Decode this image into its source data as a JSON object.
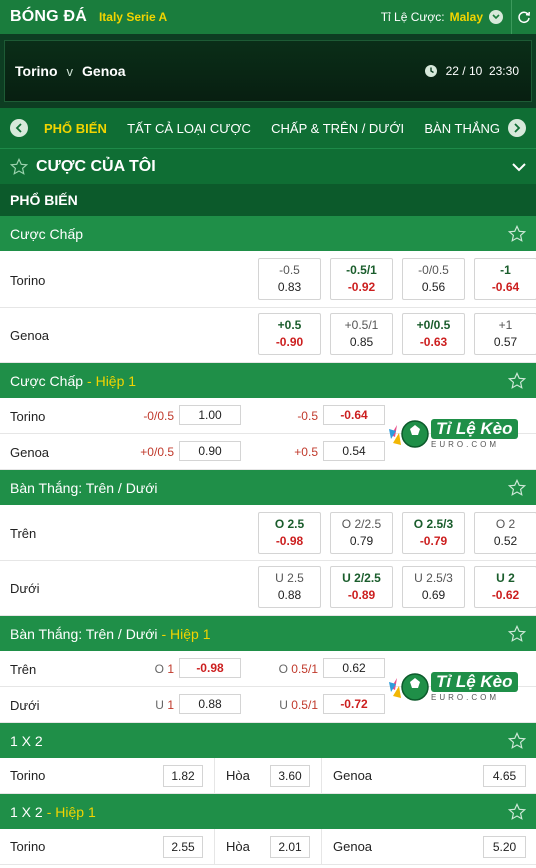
{
  "header": {
    "brand": "BÓNG ĐÁ",
    "league": "Italy Serie A",
    "odds_label": "Tỉ Lệ Cược:",
    "odds_value": "Malay"
  },
  "match": {
    "home": "Torino",
    "vs": "v",
    "away": "Genoa",
    "datetime": "22 / 10  23:30"
  },
  "tabs": [
    {
      "label": "PHỔ BIẾN",
      "active": true
    },
    {
      "label": "TẤT CẢ LOẠI CƯỢC"
    },
    {
      "label": "CHẤP & TRÊN / DƯỚI"
    },
    {
      "label": "BÀN THẮNG"
    }
  ],
  "my_bets": {
    "title": "CƯỢC CỦA TÔI"
  },
  "popular": {
    "title": "PHỔ BIẾN"
  },
  "handicap": {
    "title": "Cược Chấp",
    "rows": [
      {
        "team": "Torino",
        "cells": [
          {
            "line": "-0.5",
            "odd": "0.83"
          },
          {
            "line": "-0.5/1",
            "odd": "-0.92"
          },
          {
            "line": "-0/0.5",
            "odd": "0.56"
          },
          {
            "line": "-1",
            "odd": "-0.64"
          }
        ]
      },
      {
        "team": "Genoa",
        "cells": [
          {
            "line": "+0.5",
            "odd": "-0.90"
          },
          {
            "line": "+0.5/1",
            "odd": "0.85"
          },
          {
            "line": "+0/0.5",
            "odd": "-0.63"
          },
          {
            "line": "+1",
            "odd": "0.57"
          }
        ]
      }
    ]
  },
  "handicap_h1": {
    "title": "Cược Chấp",
    "half": "- Hiệp 1",
    "rows": [
      {
        "team": "Torino",
        "line1": "-0/0.5",
        "odd1": "1.00",
        "line2": "-0.5",
        "odd2": "-0.64"
      },
      {
        "team": "Genoa",
        "line1": "+0/0.5",
        "odd1": "0.90",
        "line2": "+0.5",
        "odd2": "0.54"
      }
    ]
  },
  "overunder": {
    "title": "Bàn Thắng: Trên / Dưới",
    "rows": [
      {
        "team": "Trên",
        "cells": [
          {
            "prefix": "O",
            "line": "2.5",
            "odd": "-0.98"
          },
          {
            "prefix": "O",
            "line": "2/2.5",
            "odd": "0.79"
          },
          {
            "prefix": "O",
            "line": "2.5/3",
            "odd": "-0.79"
          },
          {
            "prefix": "O",
            "line": "2",
            "odd": "0.52"
          }
        ]
      },
      {
        "team": "Dưới",
        "cells": [
          {
            "prefix": "U",
            "line": "2.5",
            "odd": "0.88"
          },
          {
            "prefix": "U",
            "line": "2/2.5",
            "odd": "-0.89"
          },
          {
            "prefix": "U",
            "line": "2.5/3",
            "odd": "0.69"
          },
          {
            "prefix": "U",
            "line": "2",
            "odd": "-0.62"
          }
        ]
      }
    ]
  },
  "overunder_h1": {
    "title": "Bàn Thắng: Trên / Dưới",
    "half": "- Hiệp 1",
    "rows": [
      {
        "team": "Trên",
        "prefix1": "O",
        "line1": "1",
        "odd1": "-0.98",
        "prefix2": "O",
        "line2": "0.5/1",
        "odd2": "0.62"
      },
      {
        "team": "Dưới",
        "prefix1": "U",
        "line1": "1",
        "odd1": "0.88",
        "prefix2": "U",
        "line2": "0.5/1",
        "odd2": "-0.72"
      }
    ]
  },
  "onextwo": {
    "title": "1 X 2",
    "home": "Torino",
    "home_odd": "1.82",
    "draw": "Hòa",
    "draw_odd": "3.60",
    "away": "Genoa",
    "away_odd": "4.65"
  },
  "onextwo_h1": {
    "title": "1 X 2",
    "half": "- Hiệp 1",
    "home": "Torino",
    "home_odd": "2.55",
    "draw": "Hòa",
    "draw_odd": "2.01",
    "away": "Genoa",
    "away_odd": "5.20"
  },
  "watermark": {
    "name": "Tỉ Lệ Kèo",
    "sub": "EURO.COM"
  },
  "colors": {
    "primary_green": "#1f8f48",
    "dark_green": "#0c5a2b",
    "accent_yellow": "#f2d400",
    "negative_red": "#cc1f1f"
  }
}
